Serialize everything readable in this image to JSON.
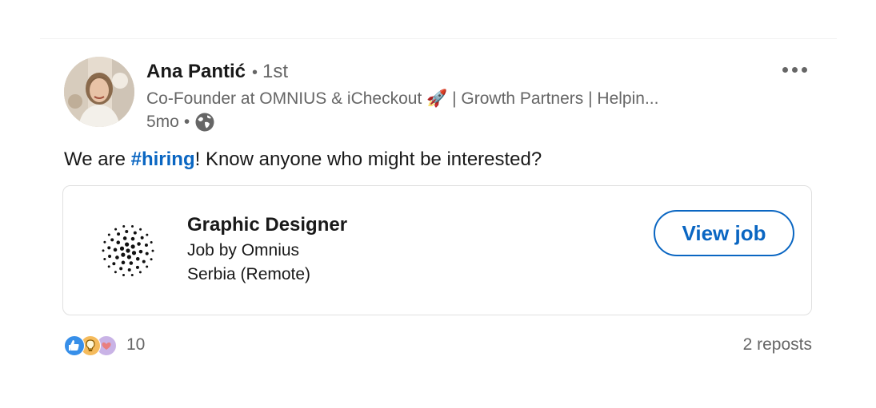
{
  "author": {
    "name": "Ana Pantić",
    "degree": "1st",
    "headline": "Co-Founder at OMNIUS & iCheckout 🚀 | Growth Partners | Helpin...",
    "time": "5mo",
    "visibility_icon": "globe-icon"
  },
  "post": {
    "text_before": "We are ",
    "hashtag": "#hiring",
    "text_after": "! Know anyone who might be interested?"
  },
  "job": {
    "title": "Graphic Designer",
    "company": "Job by Omnius",
    "location": "Serbia (Remote)",
    "button_label": "View job"
  },
  "social": {
    "reaction_icons": [
      "like-icon",
      "insightful-icon",
      "support-icon"
    ],
    "reaction_count": "10",
    "reposts": "2 reposts"
  },
  "colors": {
    "accent": "#0a66c2",
    "muted_text": "#666666",
    "card_border": "#e0e0e0"
  }
}
